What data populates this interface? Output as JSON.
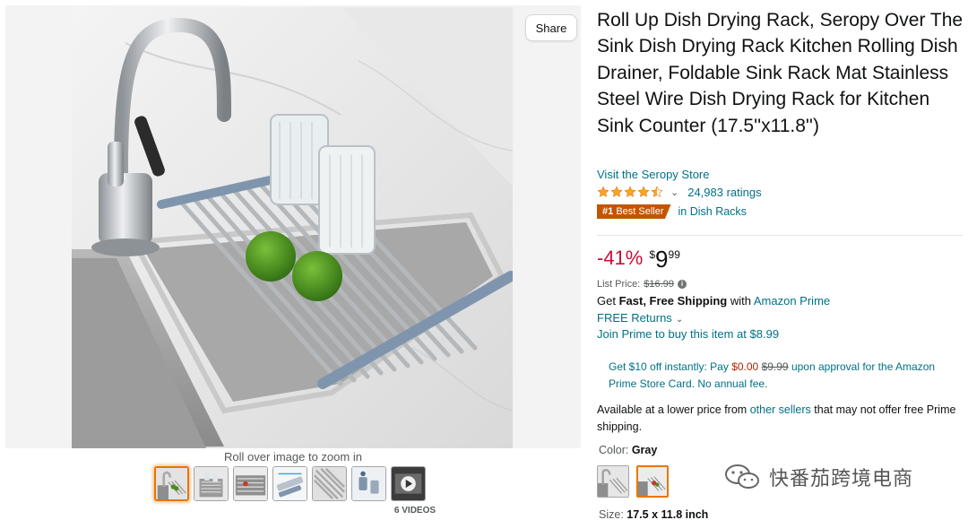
{
  "gallery": {
    "share_label": "Share",
    "zoom_hint": "Roll over image to zoom in",
    "thumbnail_count": 7,
    "videos_label": "6 VIDEOS"
  },
  "product": {
    "title": "Roll Up Dish Drying Rack, Seropy Over The Sink Dish Drying Rack Kitchen Rolling Dish Drainer, Foldable Sink Rack Mat Stainless Steel Wire Dish Drying Rack for Kitchen Sink Counter (17.5''x11.8'')",
    "store_link": "Visit the Seropy Store",
    "rating_stars": 4.5,
    "ratings_count": "24,983 ratings",
    "badge_rank": "#1",
    "badge_text": "Best Seller",
    "badge_category": "in Dish Racks"
  },
  "pricing": {
    "discount": "-41%",
    "currency": "$",
    "price_whole": "9",
    "price_fraction": "99",
    "list_price_label": "List Price:",
    "list_price": "$16.99"
  },
  "shipping": {
    "get_prefix": "Get",
    "fast_free": "Fast, Free Shipping",
    "with": "with",
    "prime_link": "Amazon Prime",
    "free_returns": "FREE Returns",
    "join_prime": "Join Prime to buy this item at $8.99"
  },
  "promo": {
    "part1": "Get $10 off instantly: Pay",
    "new_price": "$0.00",
    "old_price": "$9.99",
    "part2": "upon approval for the Amazon Prime Store Card. No annual fee."
  },
  "availability": {
    "prefix": "Available at a lower price from",
    "link": "other sellers",
    "suffix": "that may not offer free Prime shipping."
  },
  "variants": {
    "color_label": "Color:",
    "color_value": "Gray",
    "size_label": "Size:",
    "size_value": "17.5 x 11.8 inch"
  },
  "watermark": {
    "text": "快番茄跨境电商"
  },
  "colors": {
    "link": "#007185",
    "discount_red": "#cc0c39",
    "badge_orange": "#c45500",
    "star": "#ffa41c",
    "selected_border": "#e77600"
  }
}
